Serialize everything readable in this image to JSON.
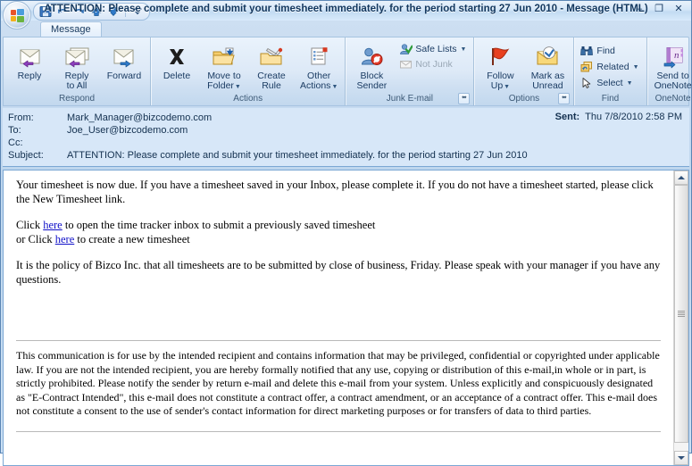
{
  "window": {
    "title": "ATTENTION: Please complete and submit your timesheet immediately. for the period starting 27 Jun 2010 - Message (HTML)",
    "minimize_label": "–",
    "maximize_label": "❐",
    "close_label": "✕"
  },
  "quick_access": {
    "items": [
      {
        "name": "save-icon",
        "tooltip": "Save"
      },
      {
        "name": "undo-icon",
        "tooltip": "Undo"
      },
      {
        "name": "redo-icon",
        "tooltip": "Redo"
      },
      {
        "name": "previous-item-icon",
        "tooltip": "Previous Item"
      },
      {
        "name": "next-item-icon",
        "tooltip": "Next Item"
      },
      {
        "name": "customize-quick-access-toolbar-icon",
        "tooltip": "Customize Quick Access Toolbar"
      }
    ]
  },
  "tabs": [
    {
      "label": "Message",
      "active": true
    }
  ],
  "ribbon": {
    "groups": [
      {
        "label": "Respond",
        "has_launcher": false,
        "buttons": [
          {
            "label": "Reply",
            "icon": "reply-icon"
          },
          {
            "label": "Reply\nto All",
            "line1": "Reply",
            "line2": "to All",
            "icon": "reply-all-icon"
          },
          {
            "label": "Forward",
            "icon": "forward-icon"
          }
        ]
      },
      {
        "label": "Actions",
        "has_launcher": false,
        "buttons": [
          {
            "label": "Delete",
            "line1": "Delete",
            "line2": "",
            "icon": "delete-icon",
            "caret": false
          },
          {
            "label": "Move to Folder",
            "line1": "Move to",
            "line2": "Folder",
            "icon": "move-to-folder-icon",
            "caret": true
          },
          {
            "label": "Create Rule",
            "line1": "Create",
            "line2": "Rule",
            "icon": "create-rule-icon",
            "caret": false
          },
          {
            "label": "Other Actions",
            "line1": "Other",
            "line2": "Actions",
            "icon": "other-actions-icon",
            "caret": true
          }
        ]
      },
      {
        "label": "Junk E-mail",
        "has_launcher": true,
        "launcher_glyph": "⬌",
        "big": {
          "line1": "Block",
          "line2": "Sender",
          "icon": "block-sender-icon"
        },
        "small": [
          {
            "label": "Safe Lists",
            "icon": "safe-lists-icon",
            "caret": true,
            "disabled": false
          },
          {
            "label": "Not Junk",
            "icon": "not-junk-icon",
            "caret": false,
            "disabled": true
          }
        ]
      },
      {
        "label": "Options",
        "has_launcher": true,
        "launcher_glyph": "⬌",
        "buttons": [
          {
            "line1": "Follow",
            "line2": "Up",
            "icon": "follow-up-flag-icon",
            "caret": true
          },
          {
            "line1": "Mark as",
            "line2": "Unread",
            "icon": "mark-as-unread-icon",
            "caret": false
          }
        ]
      },
      {
        "label": "Find",
        "has_launcher": false,
        "small": [
          {
            "label": "Find",
            "icon": "find-binoculars-icon",
            "caret": false
          },
          {
            "label": "Related",
            "icon": "related-icon",
            "caret": true
          },
          {
            "label": "Select",
            "icon": "select-pointer-icon",
            "caret": true
          }
        ]
      },
      {
        "label": "OneNote",
        "has_launcher": false,
        "big": {
          "line1": "Send to",
          "line2": "OneNote",
          "icon": "send-to-onenote-icon"
        }
      }
    ]
  },
  "header": {
    "from_label": "From:",
    "from_value": "Mark_Manager@bizcodemo.com",
    "to_label": "To:",
    "to_value": "Joe_User@bizcodemo.com",
    "cc_label": "Cc:",
    "cc_value": "",
    "subject_label": "Subject:",
    "subject_value": "ATTENTION: Please complete and submit your timesheet immediately. for the period starting 27 Jun 2010",
    "sent_label": "Sent:",
    "sent_value": "Thu 7/8/2010 2:58 PM"
  },
  "body": {
    "para1": "Your timesheet is now due. If you have a timesheet saved in your Inbox, please complete it. If you do not have a timesheet started, please click the New Timesheet link.",
    "line_click_prefix": "Click ",
    "link1_text": "here",
    "line_click_suffix": " to open the time tracker inbox to submit a previously saved timesheet",
    "line_or_prefix": "or Click ",
    "link2_text": "here",
    "line_or_suffix": " to create a new timesheet",
    "para2": "It is the policy of Bizco Inc. that all timesheets are to be submitted by close of business, Friday. Please speak with your manager if you have any questions.",
    "disclaimer": "This communication is for use by the intended recipient and contains information that may be privileged, confidential or copyrighted under applicable law. If you are not the intended recipient, you are hereby formally notified that any use, copying or distribution of this e-mail,in whole or in part, is strictly prohibited. Please notify the sender by return e-mail and delete this e-mail from your system. Unless explicitly and conspicuously designated as \"E-Contract Intended\", this e-mail does not constitute a contract offer, a contract amendment, or an acceptance of a contract offer. This e-mail does not constitute a consent to the use of sender's contact information for direct marketing purposes or for transfers of data to third parties."
  },
  "scrollbar": {
    "up_arrow": "scroll-up-arrow",
    "down_arrow": "scroll-down-arrow"
  },
  "colors": {
    "accent": "#1b3c63",
    "link": "#1010c8",
    "chrome": "#cbe0f4",
    "header_bg": "#d7e7f8",
    "flag_red": "#e03a22",
    "folder_yellow": "#f2c75c"
  }
}
